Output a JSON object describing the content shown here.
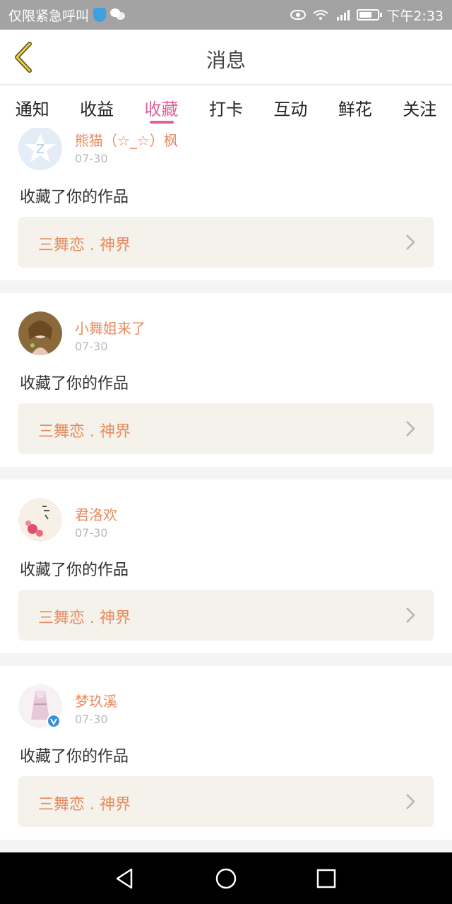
{
  "status_bar": {
    "left_text": "仅限紧急呼叫",
    "time": "下午2:33"
  },
  "header": {
    "title": "消息"
  },
  "tabs": [
    {
      "label": "通知",
      "active": false
    },
    {
      "label": "收益",
      "active": false
    },
    {
      "label": "收藏",
      "active": true
    },
    {
      "label": "打卡",
      "active": false
    },
    {
      "label": "互动",
      "active": false
    },
    {
      "label": "鲜花",
      "active": false
    },
    {
      "label": "关注",
      "active": false
    }
  ],
  "notifications": [
    {
      "user": "熊猫（☆_☆）枫",
      "date": "07-30",
      "action": "收藏了你的作品",
      "work": "三舞恋 . 神界"
    },
    {
      "user": "小舞姐来了",
      "date": "07-30",
      "action": "收藏了你的作品",
      "work": "三舞恋 . 神界"
    },
    {
      "user": "君洛欢",
      "date": "07-30",
      "action": "收藏了你的作品",
      "work": "三舞恋 . 神界"
    },
    {
      "user": "梦玖溪",
      "date": "07-30",
      "action": "收藏了你的作品",
      "work": "三舞恋 . 神界"
    }
  ],
  "colors": {
    "accent": "#e0609a",
    "name": "#e88a5e",
    "work_bg": "#f4f2ea"
  }
}
